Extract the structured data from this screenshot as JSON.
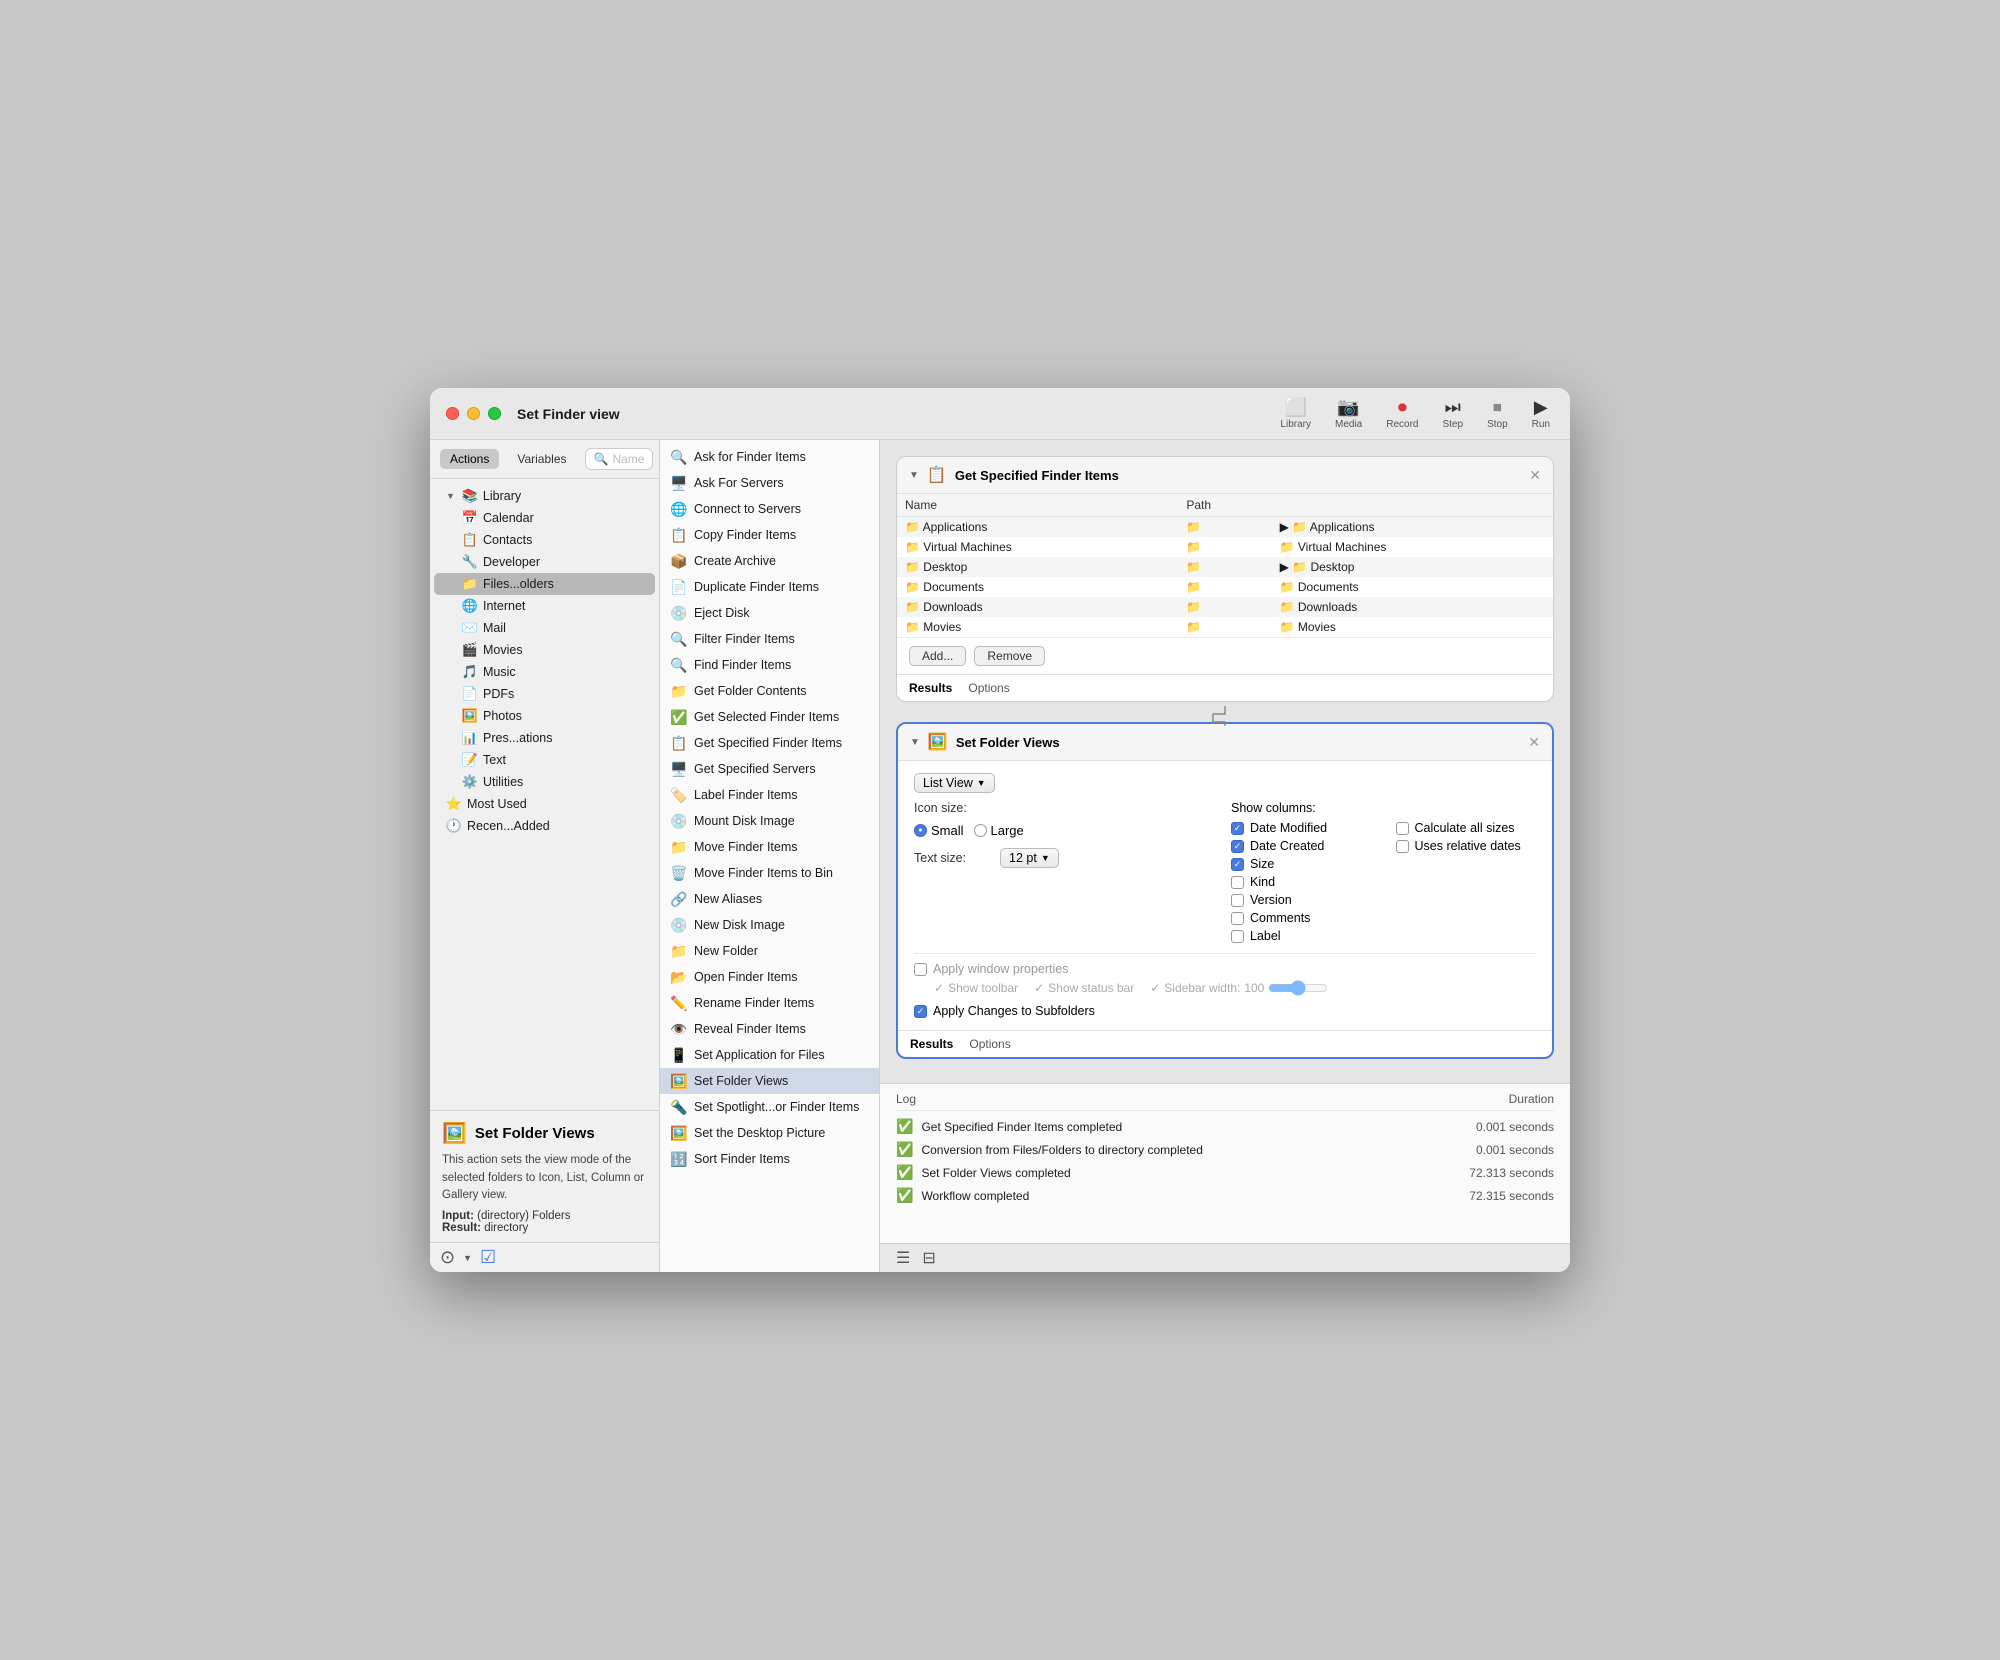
{
  "window": {
    "title": "Set Finder view",
    "toolbar": {
      "library_label": "Library",
      "media_label": "Media",
      "record_label": "Record",
      "step_label": "Step",
      "stop_label": "Stop",
      "run_label": "Run"
    }
  },
  "sidebar": {
    "tabs": [
      {
        "id": "actions",
        "label": "Actions"
      },
      {
        "id": "variables",
        "label": "Variables"
      }
    ],
    "search_placeholder": "Name",
    "tree": {
      "library_label": "Library",
      "items": [
        {
          "label": "Calendar",
          "icon": "📅",
          "indent": 1
        },
        {
          "label": "Contacts",
          "icon": "📋",
          "indent": 1
        },
        {
          "label": "Developer",
          "icon": "🔧",
          "indent": 1
        },
        {
          "label": "Files...olders",
          "icon": "📁",
          "indent": 1,
          "selected": true
        },
        {
          "label": "Internet",
          "icon": "🌐",
          "indent": 1
        },
        {
          "label": "Mail",
          "icon": "✉️",
          "indent": 1
        },
        {
          "label": "Movies",
          "icon": "🎬",
          "indent": 1
        },
        {
          "label": "Music",
          "icon": "🎵",
          "indent": 1
        },
        {
          "label": "PDFs",
          "icon": "📄",
          "indent": 1
        },
        {
          "label": "Photos",
          "icon": "🖼️",
          "indent": 1
        },
        {
          "label": "Pres...ations",
          "icon": "📊",
          "indent": 1
        },
        {
          "label": "Text",
          "icon": "📝",
          "indent": 1
        },
        {
          "label": "Utilities",
          "icon": "⚙️",
          "indent": 1
        }
      ],
      "most_used_label": "Most Used",
      "recently_added_label": "Recen...Added"
    }
  },
  "actions_list": {
    "items": [
      {
        "label": "Ask for Finder Items",
        "icon": "🔍"
      },
      {
        "label": "Ask For Servers",
        "icon": "🖥️"
      },
      {
        "label": "Connect to Servers",
        "icon": "🌐"
      },
      {
        "label": "Copy Finder Items",
        "icon": "📋"
      },
      {
        "label": "Create Archive",
        "icon": "📦"
      },
      {
        "label": "Duplicate Finder Items",
        "icon": "📄"
      },
      {
        "label": "Eject Disk",
        "icon": "💿"
      },
      {
        "label": "Filter Finder Items",
        "icon": "🔍"
      },
      {
        "label": "Find Finder Items",
        "icon": "🔍"
      },
      {
        "label": "Get Folder Contents",
        "icon": "📁"
      },
      {
        "label": "Get Selected Finder Items",
        "icon": "✅"
      },
      {
        "label": "Get Specified Finder Items",
        "icon": "📋"
      },
      {
        "label": "Get Specified Servers",
        "icon": "🖥️"
      },
      {
        "label": "Label Finder Items",
        "icon": "🏷️"
      },
      {
        "label": "Mount Disk Image",
        "icon": "💿"
      },
      {
        "label": "Move Finder Items",
        "icon": "📁"
      },
      {
        "label": "Move Finder Items to Bin",
        "icon": "🗑️"
      },
      {
        "label": "New Aliases",
        "icon": "🔗"
      },
      {
        "label": "New Disk Image",
        "icon": "💿"
      },
      {
        "label": "New Folder",
        "icon": "📁"
      },
      {
        "label": "Open Finder Items",
        "icon": "📂"
      },
      {
        "label": "Rename Finder Items",
        "icon": "✏️"
      },
      {
        "label": "Reveal Finder Items",
        "icon": "👁️"
      },
      {
        "label": "Set Application for Files",
        "icon": "📱"
      },
      {
        "label": "Set Folder Views",
        "icon": "🖼️",
        "selected": true
      },
      {
        "label": "Set Spotlight...or Finder Items",
        "icon": "🔦"
      },
      {
        "label": "Set the Desktop Picture",
        "icon": "🖼️"
      },
      {
        "label": "Sort Finder Items",
        "icon": "🔢"
      }
    ]
  },
  "card1": {
    "title": "Get Specified Finder Items",
    "columns": [
      "Name",
      "Path"
    ],
    "files": [
      {
        "name": "Applications",
        "path": "Applications"
      },
      {
        "name": "Virtual Machines",
        "path": "Virtual Machines"
      },
      {
        "name": "Desktop",
        "path": "Desktop"
      },
      {
        "name": "Documents",
        "path": "Documents"
      },
      {
        "name": "Downloads",
        "path": "Downloads"
      },
      {
        "name": "Movies",
        "path": "Movies"
      }
    ],
    "add_label": "Add...",
    "remove_label": "Remove",
    "results_tab": "Results",
    "options_tab": "Options"
  },
  "card2": {
    "title": "Set Folder Views",
    "view_mode": "List View",
    "icon_size_label": "Icon size:",
    "small_label": "Small",
    "large_label": "Large",
    "text_size_label": "Text size:",
    "text_size_value": "12 pt",
    "show_columns_label": "Show columns:",
    "columns": [
      {
        "label": "Date Modified",
        "checked": true
      },
      {
        "label": "Calculate all sizes",
        "checked": false
      },
      {
        "label": "Date Created",
        "checked": true
      },
      {
        "label": "Uses relative dates",
        "checked": false
      },
      {
        "label": "Size",
        "checked": true
      },
      {
        "label": "Kind",
        "checked": false
      },
      {
        "label": "Version",
        "checked": false
      },
      {
        "label": "Comments",
        "checked": false
      },
      {
        "label": "Label",
        "checked": false
      }
    ],
    "apply_window_label": "Apply window properties",
    "show_toolbar_label": "Show toolbar",
    "show_status_bar_label": "Show status bar",
    "sidebar_width_label": "Sidebar width:",
    "sidebar_width_value": "100",
    "apply_changes_label": "Apply Changes to Subfolders",
    "results_tab": "Results",
    "options_tab": "Options"
  },
  "log": {
    "header_label": "Log",
    "duration_label": "Duration",
    "entries": [
      {
        "text": "Get Specified Finder Items completed",
        "duration": "0.001 seconds",
        "status": "success"
      },
      {
        "text": "Conversion from Files/Folders to directory completed",
        "duration": "0.001 seconds",
        "status": "success"
      },
      {
        "text": "Set Folder Views completed",
        "duration": "72.313 seconds",
        "status": "success"
      },
      {
        "text": "Workflow completed",
        "duration": "72.315 seconds",
        "status": "success"
      }
    ]
  },
  "bottom": {
    "action_title": "Set Folder Views",
    "description": "This action sets the view mode of the selected folders to Icon, List, Column or Gallery view.",
    "input_label": "Input:",
    "input_value": "(directory) Folders",
    "result_label": "Result:",
    "result_value": "directory"
  }
}
